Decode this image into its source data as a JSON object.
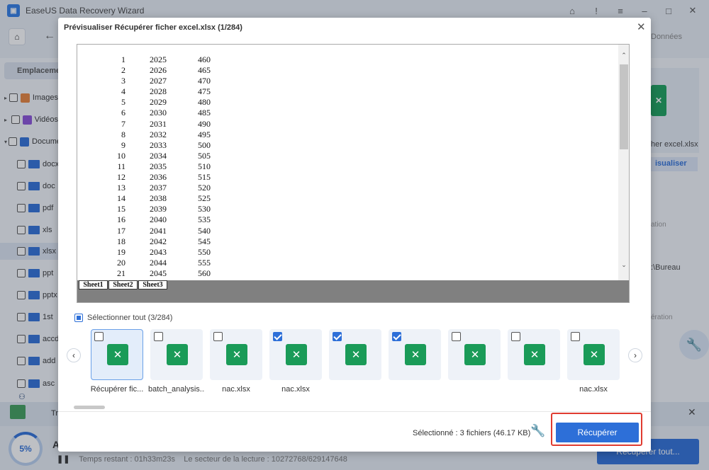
{
  "app": {
    "title": "EaseUS Data Recovery Wizard",
    "window_controls": [
      "⌂",
      "!",
      "≡",
      "–",
      "□",
      "✕"
    ]
  },
  "background": {
    "right_header": "Données",
    "location_tab": "Emplacement",
    "tree": [
      {
        "label": "Images",
        "kind": "category",
        "color": "#e8833a"
      },
      {
        "label": "Vidéos",
        "kind": "category",
        "color": "#8a4fd8"
      },
      {
        "label": "Documents",
        "kind": "category",
        "color": "#2d6fd8"
      },
      {
        "label": "docx",
        "kind": "folder"
      },
      {
        "label": "doc",
        "kind": "folder"
      },
      {
        "label": "pdf",
        "kind": "folder"
      },
      {
        "label": "xls",
        "kind": "folder"
      },
      {
        "label": "xlsx",
        "kind": "folder",
        "selected": true
      },
      {
        "label": "ppt",
        "kind": "folder"
      },
      {
        "label": "pptx",
        "kind": "folder"
      },
      {
        "label": "1st",
        "kind": "folder"
      },
      {
        "label": "accdb",
        "kind": "folder"
      },
      {
        "label": "add",
        "kind": "folder"
      },
      {
        "label": "asc",
        "kind": "folder"
      }
    ],
    "right_panel": {
      "file_name": "her excel.xlsx",
      "preview_btn": "isualiser",
      "label_1": "ation",
      "path": ":\\Bureau",
      "label_2": "ération"
    },
    "strip_text": "Tr",
    "status": {
      "progress": "5%",
      "status_title": "A",
      "time_remaining": "Temps restant : 01h33m23s",
      "sector": "Le secteur de la lecture : 10272768/629147648",
      "recover_all_label": "Récupérer tout..."
    }
  },
  "dialog": {
    "title": "Prévisualiser Récupérer ficher excel.xlsx (1/284)",
    "spreadsheet": {
      "rows": [
        [
          "1",
          "2025",
          "460"
        ],
        [
          "2",
          "2026",
          "465"
        ],
        [
          "3",
          "2027",
          "470"
        ],
        [
          "4",
          "2028",
          "475"
        ],
        [
          "5",
          "2029",
          "480"
        ],
        [
          "6",
          "2030",
          "485"
        ],
        [
          "7",
          "2031",
          "490"
        ],
        [
          "8",
          "2032",
          "495"
        ],
        [
          "9",
          "2033",
          "500"
        ],
        [
          "10",
          "2034",
          "505"
        ],
        [
          "11",
          "2035",
          "510"
        ],
        [
          "12",
          "2036",
          "515"
        ],
        [
          "13",
          "2037",
          "520"
        ],
        [
          "14",
          "2038",
          "525"
        ],
        [
          "15",
          "2039",
          "530"
        ],
        [
          "16",
          "2040",
          "535"
        ],
        [
          "17",
          "2041",
          "540"
        ],
        [
          "18",
          "2042",
          "545"
        ],
        [
          "19",
          "2043",
          "550"
        ],
        [
          "20",
          "2044",
          "555"
        ],
        [
          "21",
          "2045",
          "560"
        ]
      ],
      "sheets": [
        "Sheet1",
        "Sheet2",
        "Sheet3"
      ]
    },
    "select_all_label": "Sélectionner tout (3/284)",
    "thumbnails": [
      {
        "label": "Récupérer fic...",
        "checked": false,
        "active": true
      },
      {
        "label": "batch_analysis...",
        "checked": false
      },
      {
        "label": "nac.xlsx",
        "checked": false
      },
      {
        "label": "nac.xlsx",
        "checked": true
      },
      {
        "label": "",
        "checked": true
      },
      {
        "label": "",
        "checked": true
      },
      {
        "label": "",
        "checked": false
      },
      {
        "label": "",
        "checked": false
      },
      {
        "label": "nac.xlsx",
        "checked": false
      }
    ],
    "nav": {
      "prev": "‹",
      "next": "›"
    },
    "selected_text": "Sélectionné : 3 fichiers (46.17 KB)",
    "recover_label": "Récupérer",
    "close_glyph": "✕",
    "xl_glyph": "✕",
    "accent_color": "#2d6fd8",
    "excel_color": "#1a9b58",
    "highlight_color": "#e03c31"
  }
}
